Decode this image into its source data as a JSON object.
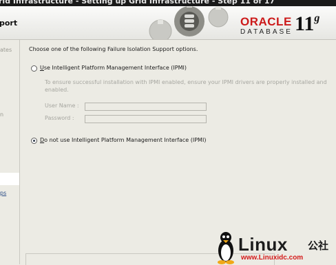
{
  "window": {
    "title": "rid Infrastructure - Setting up Grid Infrastructure - Step 11 of 17"
  },
  "header": {
    "page_title": "port",
    "brand": "ORACLE",
    "product": "DATABASE",
    "version": "11",
    "version_suffix": "g"
  },
  "sidebar": {
    "items": [
      {
        "label": "ates"
      },
      {
        "label": "n"
      }
    ],
    "link": "ps"
  },
  "main": {
    "instruction": "Choose one of the following Failure Isolation Support options.",
    "option_ipmi": {
      "mnemonic": "U",
      "label_rest": "se Intelligent Platform Management Interface (IPMI)",
      "selected": false
    },
    "help_text": "To ensure successful installation with IPMI enabled, ensure your IPMI drivers are properly installed and enabled.",
    "user_name": {
      "label": "User Name :",
      "value": ""
    },
    "password": {
      "label": "Password :",
      "value": ""
    },
    "option_no_ipmi": {
      "mnemonic": "D",
      "label_rest": "o not use Intelligent Platform Management Interface (IPMI)",
      "selected": true
    }
  },
  "watermark": {
    "text": "Linux",
    "cn": "公社",
    "url": "www.Linuxidc.com"
  }
}
